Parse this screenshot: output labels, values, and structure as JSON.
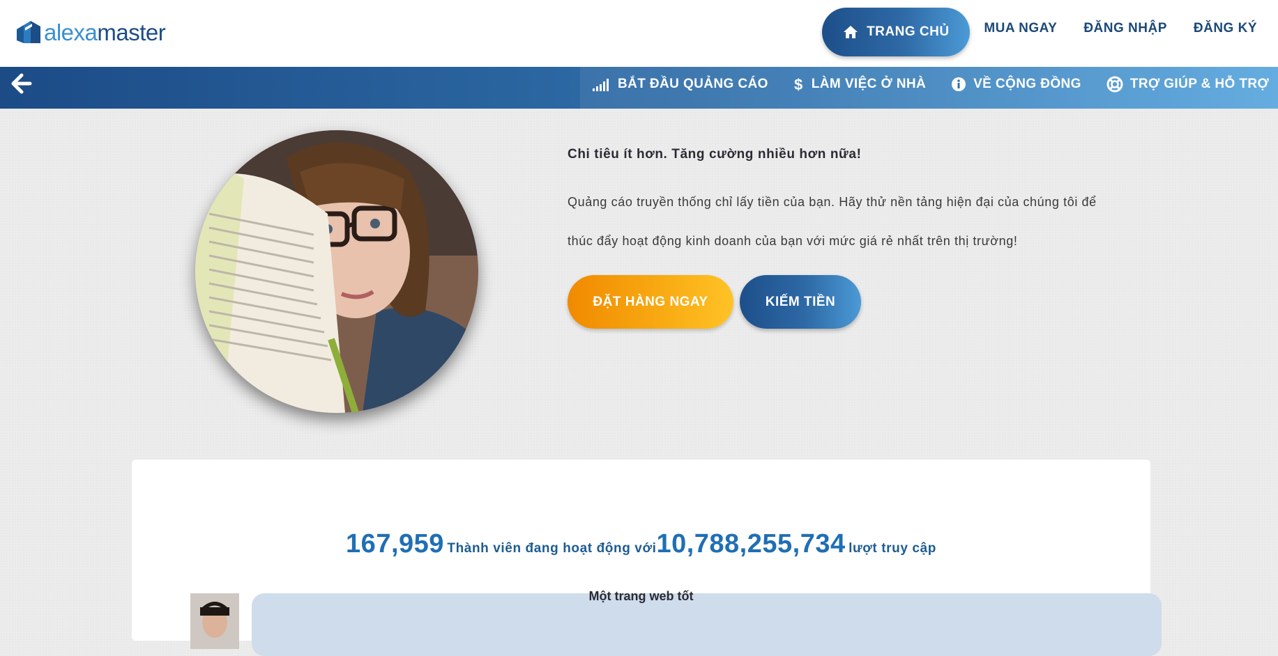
{
  "brand": {
    "logo_left": "alexa",
    "logo_right": "master"
  },
  "topnav": {
    "home": "TRANG CHỦ",
    "buy": "MUA NGAY",
    "login": "ĐĂNG NHẬP",
    "register": "ĐĂNG KÝ"
  },
  "subnav": {
    "items": [
      {
        "label": "BẮT ĐẦU QUẢNG CÁO",
        "icon": "signal-bars-icon"
      },
      {
        "label": "LÀM VIỆC Ở NHÀ",
        "icon": "dollar-icon"
      },
      {
        "label": "VỀ CỘNG ĐỒNG",
        "icon": "info-icon"
      },
      {
        "label": "TRỢ GIÚP & HỖ TRỢ",
        "icon": "lifebuoy-icon"
      }
    ]
  },
  "hero": {
    "title": "Chi tiêu ít hơn. Tăng cường nhiều hơn nữa!",
    "line1": "Quảng cáo truyền thống chỉ lấy tiền của bạn. Hãy thử nền tảng hiện đại của chúng tôi để",
    "line2": "thúc đẩy hoạt động kinh doanh của bạn với mức giá rẻ nhất trên thị trường!",
    "order_button": "ĐẶT HÀNG NGAY",
    "earn_button": "KIẾM TIỀN"
  },
  "stats": {
    "members": "167,959",
    "members_text": "Thành viên đang hoạt động với",
    "visits": "10,788,255,734",
    "visits_text": "lượt truy cập"
  },
  "review": {
    "text": "Một trang web tốt"
  },
  "colors": {
    "brand_dark": "#1c4b86",
    "brand_light": "#58a6de",
    "orange": "#f8a912",
    "stat_blue": "#1f6fb4"
  }
}
